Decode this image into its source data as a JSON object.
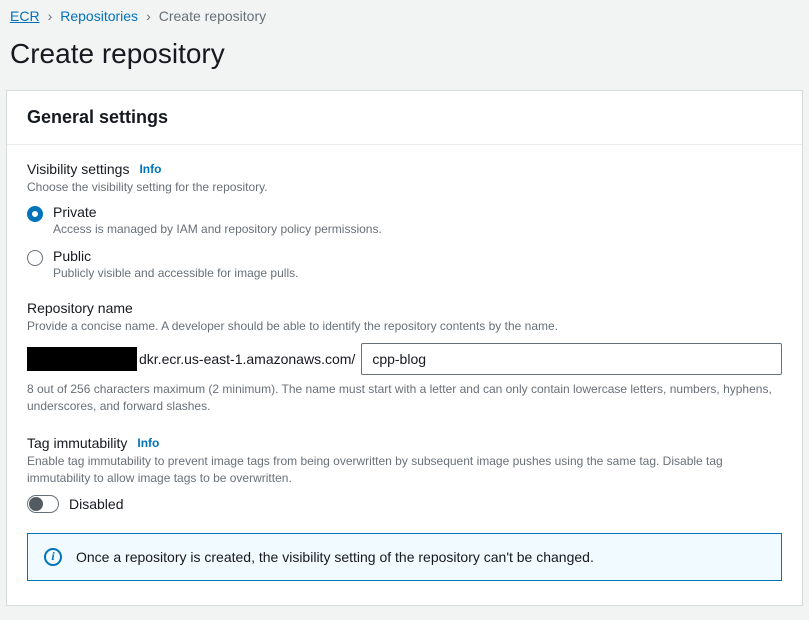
{
  "breadcrumb": {
    "root": "ECR",
    "mid": "Repositories",
    "current": "Create repository"
  },
  "page": {
    "title": "Create repository"
  },
  "panel": {
    "header": "General settings"
  },
  "visibility": {
    "label": "Visibility settings",
    "info": "Info",
    "desc": "Choose the visibility setting for the repository.",
    "private": {
      "label": "Private",
      "desc": "Access is managed by IAM and repository policy permissions."
    },
    "public": {
      "label": "Public",
      "desc": "Publicly visible and accessible for image pulls."
    }
  },
  "repoName": {
    "label": "Repository name",
    "desc": "Provide a concise name. A developer should be able to identify the repository contents by the name.",
    "registrySuffix": "dkr.ecr.us-east-1.amazonaws.com/",
    "value": "cpp-blog",
    "hint": "8 out of 256 characters maximum (2 minimum). The name must start with a letter and can only contain lowercase letters, numbers, hyphens, underscores, and forward slashes."
  },
  "tagImmutability": {
    "label": "Tag immutability",
    "info": "Info",
    "desc": "Enable tag immutability to prevent image tags from being overwritten by subsequent image pushes using the same tag. Disable tag immutability to allow image tags to be overwritten.",
    "state": "Disabled"
  },
  "alert": {
    "text": "Once a repository is created, the visibility setting of the repository can't be changed."
  }
}
